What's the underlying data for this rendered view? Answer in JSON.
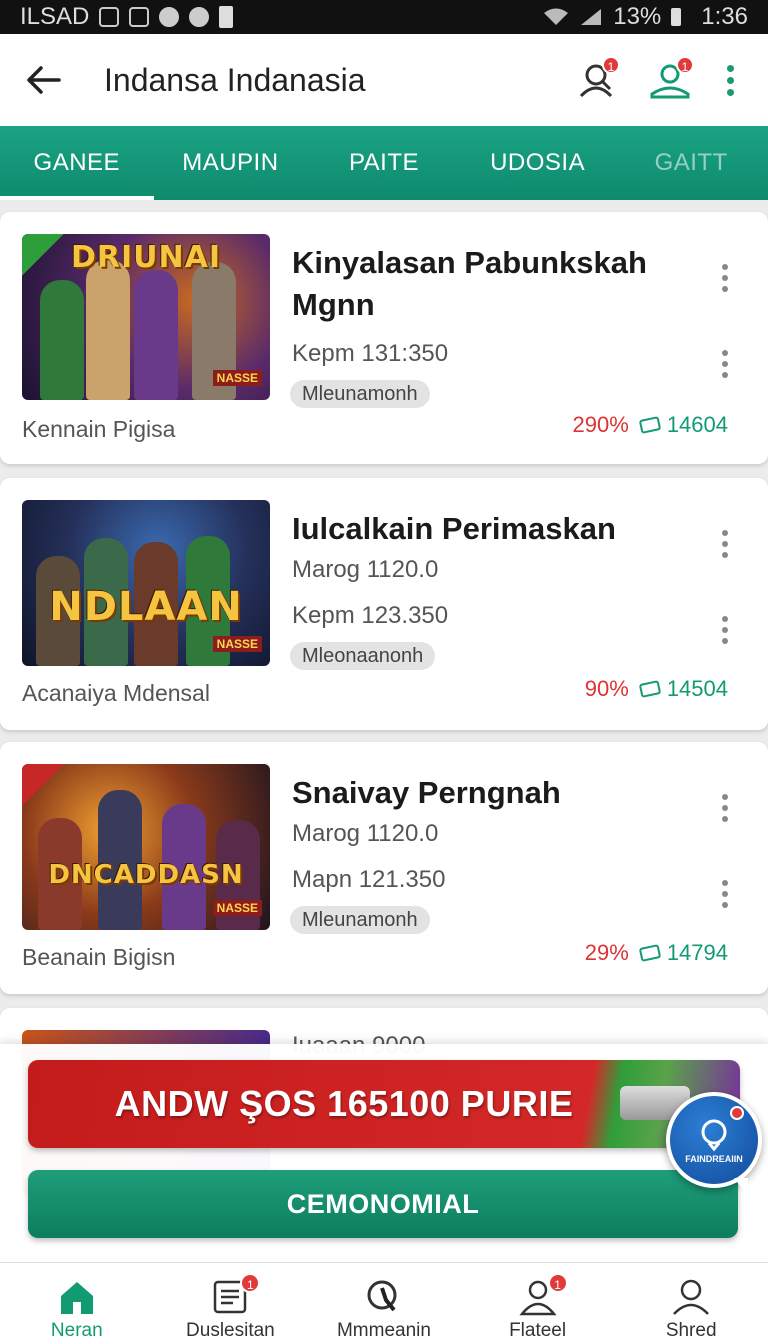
{
  "status_bar": {
    "carrier": "ILSAD",
    "battery": "13%",
    "time": "1:36"
  },
  "app_bar": {
    "title": "Indansa Indanasia",
    "icons": [
      "back-arrow-icon",
      "user-search-icon",
      "user-hat-icon",
      "more-vertical-icon"
    ],
    "badges": {
      "user_search": "1",
      "user_hat": "1"
    }
  },
  "tabs": [
    {
      "label": "GANEE",
      "active": true
    },
    {
      "label": "MAUPIN",
      "active": false
    },
    {
      "label": "PAITE",
      "active": false
    },
    {
      "label": "UDOSIA",
      "active": false
    },
    {
      "label": "GAITT",
      "active": false
    }
  ],
  "cards": [
    {
      "title": "Kinyalasan Pabunkskah Mgnn",
      "line1": "",
      "line2": "Kepm 131:350",
      "chip": "Mleunamonh",
      "subtitle": "Kennain Pigisa",
      "percent": "290%",
      "count": "14604",
      "thumb_logo": "DRIUNAI",
      "thumb_tag": "NASSE",
      "accent": "#3c1f5a"
    },
    {
      "title": "Iulcalkain Perimaskan",
      "line1": "Marog 1120.0",
      "line2": "Kepm 123.350",
      "chip": "Mleonaanonh",
      "subtitle": "Acanaiya Mdensal",
      "percent": "90%",
      "count": "14504",
      "thumb_logo": "NDLAAN",
      "thumb_tag": "NASSE",
      "accent": "#1d3a6a"
    },
    {
      "title": "Snaivay Perngnah",
      "line1": "Marog 1120.0",
      "line2": "Mapn 121.350",
      "chip": "Mleunamonh",
      "subtitle": "Beanain Bigisn",
      "percent": "29%",
      "count": "14794",
      "thumb_logo": "DNCADDASN",
      "thumb_tag": "NASSE",
      "accent": "#6a2a10"
    }
  ],
  "partial_card": {
    "line1": "Iuaaan 9000"
  },
  "promo_banner": {
    "text": "ANDW ŞOS 165100 PURIE"
  },
  "cta_button": {
    "label": "CEMONOMIAL"
  },
  "chat_fab": {
    "label": "FAINDREAIIN"
  },
  "bottom_nav": [
    {
      "label": "Neran",
      "icon": "home-icon",
      "active": true,
      "badge": ""
    },
    {
      "label": "Duslesitan",
      "icon": "document-icon",
      "active": false,
      "badge": "1"
    },
    {
      "label": "Mmmeanin",
      "icon": "search-icon",
      "active": false,
      "badge": ""
    },
    {
      "label": "Flateel",
      "icon": "person-icon",
      "active": false,
      "badge": "1"
    },
    {
      "label": "Shred",
      "icon": "profile-icon",
      "active": false,
      "badge": ""
    }
  ],
  "colors": {
    "primary": "#129a73",
    "badge": "#e03a3a",
    "promo_red": "#c31b1b",
    "percent_red": "#d33333"
  }
}
